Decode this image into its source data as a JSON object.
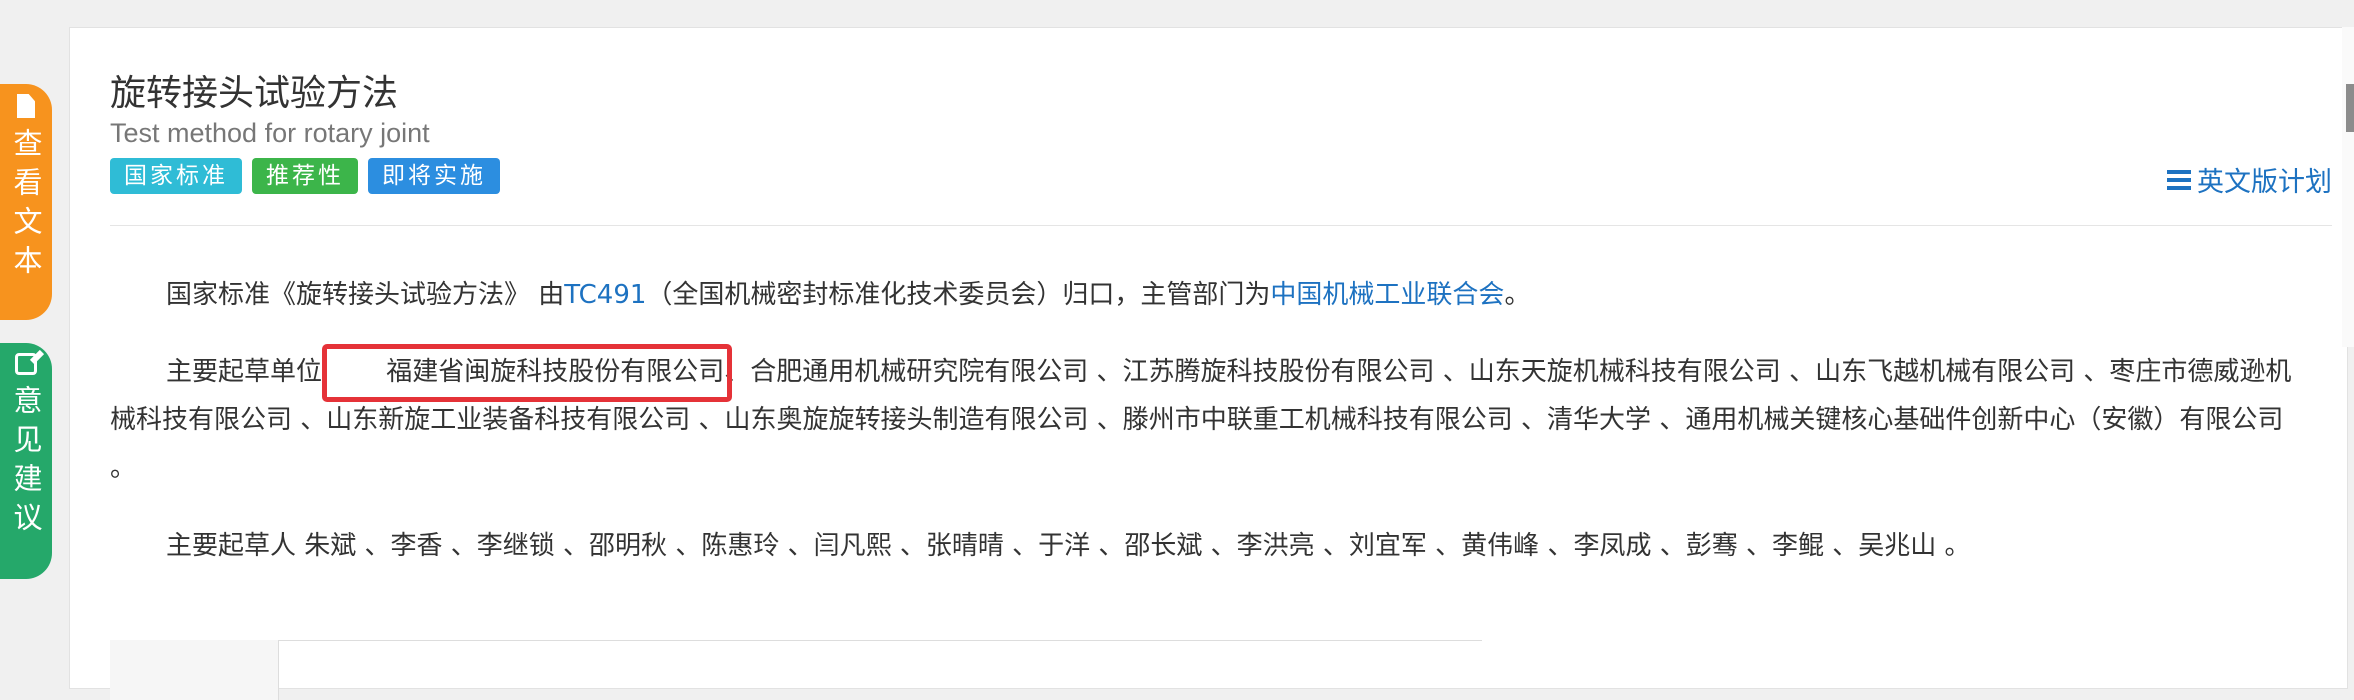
{
  "standard": {
    "title_cn": "旋转接头试验方法",
    "title_en": "Test method for rotary joint",
    "badges": [
      "国家标准",
      "推荐性",
      "即将实施"
    ],
    "en_plan_link": "英文版计划"
  },
  "float_tabs": {
    "view_text": "查看文本",
    "feedback": "意见建议"
  },
  "intro": {
    "pre": "国家标准《旋转接头试验方法》 由",
    "tc": "TC491",
    "mid": "（全国机械密封标准化技术委员会）归口，主管部门为",
    "dept": "中国机械工业联合会",
    "end": "。"
  },
  "drafting_units": {
    "label": "主要起草单位 ",
    "highlighted": "福建省闽旋科技股份有限公司",
    "rest": "、合肥通用机械研究院有限公司 、江苏腾旋科技股份有限公司 、山东天旋机械科技有限公司 、山东飞越机械有限公司 、枣庄市德威逊机械科技有限公司 、山东新旋工业装备科技有限公司 、山东奥旋旋转接头制造有限公司 、滕州市中联重工机械科技有限公司 、清华大学 、通用机械关键核心基础件创新中心（安徽）有限公司 。"
  },
  "drafters": {
    "label": "主要起草人 ",
    "names": "朱斌 、李香 、李继锁 、邵明秋 、陈惠玲 、闫凡熙 、张晴晴 、于洋 、邵长斌 、李洪亮 、刘宜军 、黄伟峰 、李凤成 、彭骞 、李鲲 、吴兆山 。"
  }
}
